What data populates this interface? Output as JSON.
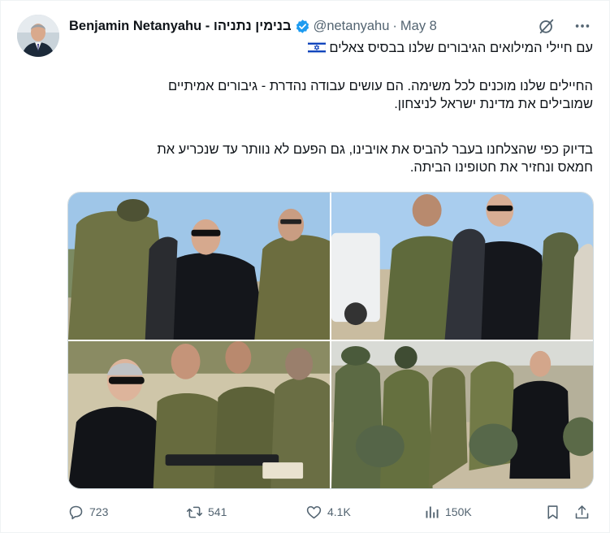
{
  "author": {
    "display_name": "Benjamin Netanyahu - בנימין נתניהו",
    "handle": "@netanyahu",
    "separator": "·",
    "date": "May 8"
  },
  "icons": {
    "verified": "verified-badge-icon",
    "grok": "grok-icon",
    "more": "more-icon",
    "flag": "israel-flag-icon"
  },
  "colors": {
    "verified_blue": "#1d9bf0",
    "text_secondary": "#536471",
    "flag_blue": "#0038b8"
  },
  "tweet": {
    "line1": "עם חיילי המילואים הגיבורים שלנו בבסיס צאלים",
    "para2_line1": "החיילים שלנו מוכנים לכל משימה. הם עושים עבודה נהדרת - גיבורים אמיתיים",
    "para2_line2": "שמובילים את מדינת ישראל לניצחון.",
    "para3_line1": "בדיוק כפי שהצלחנו בעבר להביס את אויבינו, גם הפעם לא נוותר עד שנכריע את",
    "para3_line2": "חמאס ונחזיר את חטופינו הביתה."
  },
  "stats": {
    "replies": "723",
    "reposts": "541",
    "likes": "4.1K",
    "views": "150K"
  }
}
